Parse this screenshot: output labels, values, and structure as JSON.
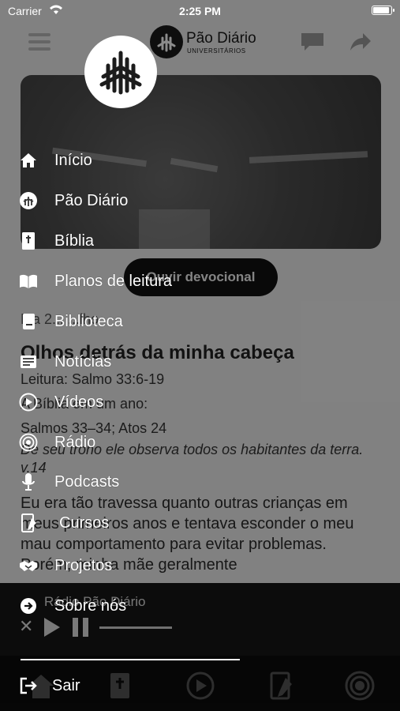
{
  "status_bar": {
    "carrier": "Carrier",
    "time": "2:25 PM"
  },
  "app_header": {
    "brand_name": "Pão Diário",
    "brand_sub": "UNIVERSITÁRIOS"
  },
  "devotional": {
    "play_button": "Ouvir devocional",
    "date": "Ma 2... ...lho",
    "title": "Olhos detrás da minha cabeça",
    "reading": "Leitura: Salmo 33:6-19",
    "bible_in_year_label": "A Bíblia em um ano:",
    "bible_in_year_refs": "Salmos 33–34; Atos 24",
    "verse": "De seu trono ele observa todos os habitantes da terra. v.14",
    "body": "Eu era tão travessa quanto outras crianças em meus primeiros anos e tentava esconder o meu mau comportamento para evitar problemas. Porém, minha mãe geralmente"
  },
  "player": {
    "title": "Rádio Pão Diário"
  },
  "drawer": {
    "items": [
      {
        "label": "Início",
        "icon": "home-icon"
      },
      {
        "label": "Pão Diário",
        "icon": "pao-diario-icon"
      },
      {
        "label": "Bíblia",
        "icon": "bible-icon"
      },
      {
        "label": "Planos de leitura",
        "icon": "open-book-icon"
      },
      {
        "label": "Biblioteca",
        "icon": "library-book-icon"
      },
      {
        "label": "Notícias",
        "icon": "news-icon"
      },
      {
        "label": "Vídeos",
        "icon": "play-circle-icon"
      },
      {
        "label": "Rádio",
        "icon": "radio-icon"
      },
      {
        "label": "Podcasts",
        "icon": "microphone-icon"
      },
      {
        "label": "Cursos",
        "icon": "course-notebook-icon"
      },
      {
        "label": "Projetos",
        "icon": "handshake-icon"
      },
      {
        "label": "Sobre nós",
        "icon": "arrow-circle-icon"
      }
    ],
    "logout": {
      "label": "Sair",
      "icon": "logout-icon"
    }
  }
}
